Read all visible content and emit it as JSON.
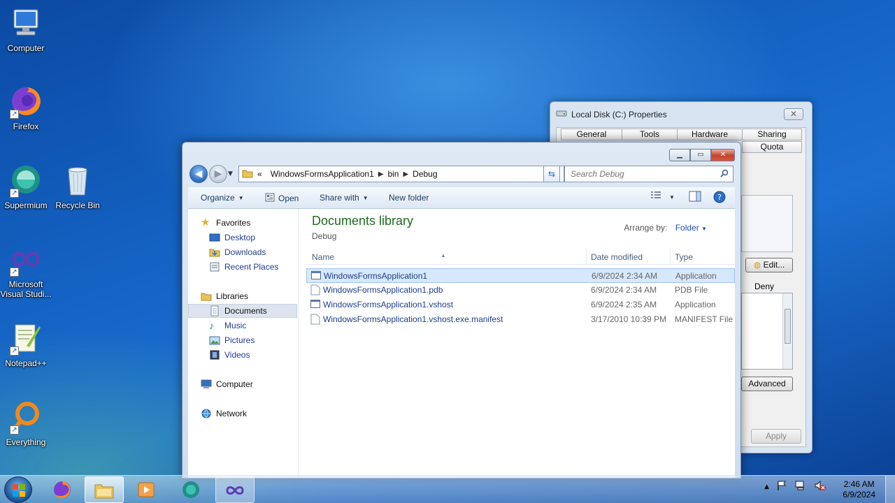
{
  "desktop": {
    "icons": [
      {
        "label": "Computer"
      },
      {
        "label": "Firefox"
      },
      {
        "label": "Supermium"
      },
      {
        "label": "Recycle Bin"
      },
      {
        "label": "Microsoft Visual Studi..."
      },
      {
        "label": "Notepad++"
      },
      {
        "label": "Everything"
      }
    ]
  },
  "properties_dialog": {
    "title": "Local Disk (C:) Properties",
    "close": "✕",
    "tabs": [
      "General",
      "Tools",
      "Hardware",
      "Sharing",
      "Quota"
    ],
    "edit_button": "Edit...",
    "deny_label": "Deny",
    "advanced_button": "Advanced",
    "apply_button": "Apply"
  },
  "explorer": {
    "breadcrumb": {
      "prefix": "«",
      "parts": [
        "WindowsFormsApplication1",
        "bin",
        "Debug"
      ]
    },
    "search_placeholder": "Search Debug",
    "toolbar": {
      "organize": "Organize",
      "open": "Open",
      "share_with": "Share with",
      "new_folder": "New folder"
    },
    "nav": {
      "favorites": "Favorites",
      "desktop": "Desktop",
      "downloads": "Downloads",
      "recent_places": "Recent Places",
      "libraries": "Libraries",
      "documents": "Documents",
      "music": "Music",
      "pictures": "Pictures",
      "videos": "Videos",
      "computer": "Computer",
      "network": "Network"
    },
    "library_title": "Documents library",
    "library_sub": "Debug",
    "arrange_label": "Arrange by:",
    "arrange_value": "Folder",
    "columns": {
      "name": "Name",
      "date": "Date modified",
      "type": "Type"
    },
    "files": [
      {
        "name": "WindowsFormsApplication1",
        "date": "6/9/2024 2:34 AM",
        "type": "Application"
      },
      {
        "name": "WindowsFormsApplication1.pdb",
        "date": "6/9/2024 2:34 AM",
        "type": "PDB File"
      },
      {
        "name": "WindowsFormsApplication1.vshost",
        "date": "6/9/2024 2:35 AM",
        "type": "Application"
      },
      {
        "name": "WindowsFormsApplication1.vshost.exe.manifest",
        "date": "3/17/2010 10:39 PM",
        "type": "MANIFEST File"
      }
    ]
  },
  "taskbar": {
    "time": "2:46 AM",
    "date": "6/9/2024"
  },
  "colors": {
    "accent_link": "#1e3e8c",
    "library_title": "#1e6b1e",
    "selection": "#d6e8fb"
  }
}
